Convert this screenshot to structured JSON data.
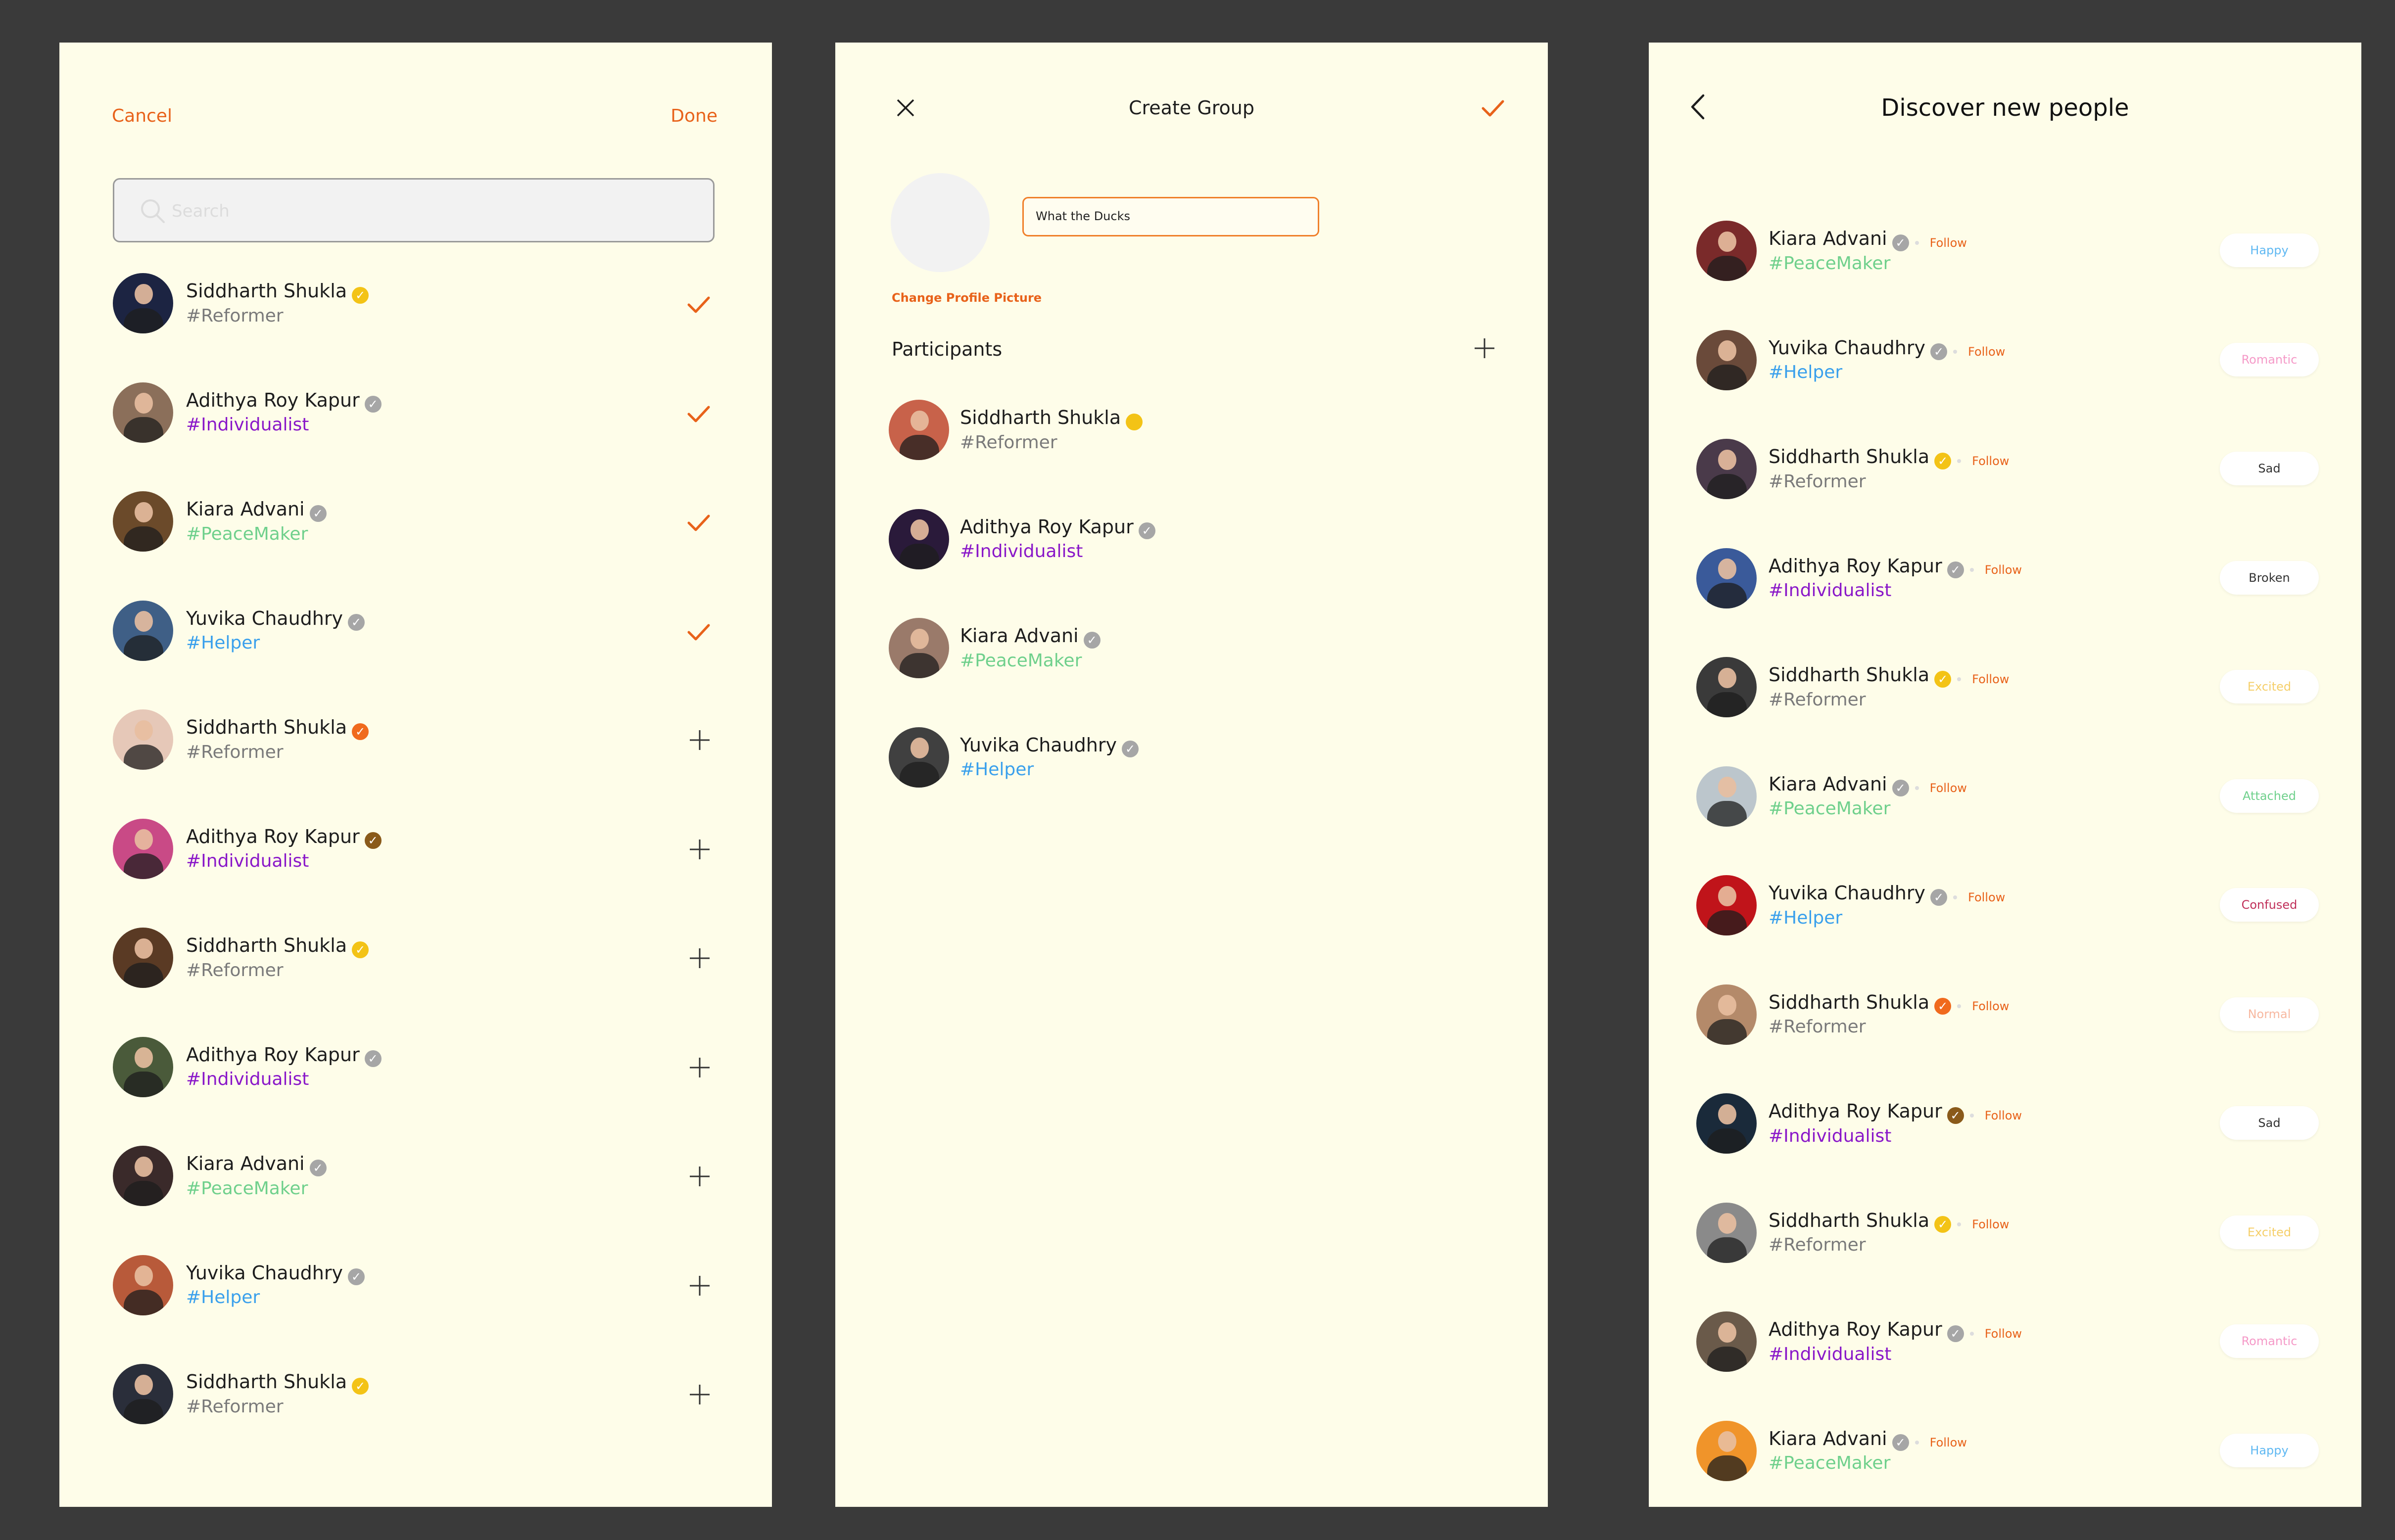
{
  "colors": {
    "accent": "#e8621a",
    "panel_bg": "#fefde9",
    "canvas_bg": "#3a3a3a",
    "tag_reformer": "#7a7a7a",
    "tag_individualist": "#8a18c9",
    "tag_peacemaker": "#6fd08c",
    "tag_helper": "#3aa0ec",
    "badge_yellow": "#f3c316",
    "badge_grey": "#a6a6a6",
    "badge_orange": "#f06a1d",
    "badge_brown": "#8a5a1a"
  },
  "select_panel": {
    "cancel_label": "Cancel",
    "done_label": "Done",
    "search_placeholder": "Search",
    "rows": [
      {
        "name": "Siddharth Shukla",
        "tag": "#Reformer",
        "tag_color": "#7a7a7a",
        "badge": "yellow",
        "selected": true,
        "avatar_bg": "#1c2442"
      },
      {
        "name": "Adithya Roy Kapur",
        "tag": "#Individualist",
        "tag_color": "#8a18c9",
        "badge": "grey",
        "selected": true,
        "avatar_bg": "#8b6f5a"
      },
      {
        "name": "Kiara Advani",
        "tag": "#PeaceMaker",
        "tag_color": "#6fd08c",
        "badge": "grey",
        "selected": true,
        "avatar_bg": "#6b4a2a"
      },
      {
        "name": "Yuvika Chaudhry",
        "tag": "#Helper",
        "tag_color": "#3aa0ec",
        "badge": "grey",
        "selected": true,
        "avatar_bg": "#3f5f86"
      },
      {
        "name": "Siddharth Shukla",
        "tag": "#Reformer",
        "tag_color": "#7a7a7a",
        "badge": "orange",
        "selected": false,
        "avatar_bg": "#e6c8b8"
      },
      {
        "name": "Adithya Roy Kapur",
        "tag": "#Individualist",
        "tag_color": "#8a18c9",
        "badge": "brown",
        "selected": false,
        "avatar_bg": "#c94a86"
      },
      {
        "name": "Siddharth Shukla",
        "tag": "#Reformer",
        "tag_color": "#7a7a7a",
        "badge": "yellow",
        "selected": false,
        "avatar_bg": "#5a3a24"
      },
      {
        "name": "Adithya Roy Kapur",
        "tag": "#Individualist",
        "tag_color": "#8a18c9",
        "badge": "grey",
        "selected": false,
        "avatar_bg": "#4a5a3a"
      },
      {
        "name": "Kiara Advani",
        "tag": "#PeaceMaker",
        "tag_color": "#6fd08c",
        "badge": "grey",
        "selected": false,
        "avatar_bg": "#3a2a2a"
      },
      {
        "name": "Yuvika Chaudhry",
        "tag": "#Helper",
        "tag_color": "#3aa0ec",
        "badge": "grey",
        "selected": false,
        "avatar_bg": "#b85a3a"
      },
      {
        "name": "Siddharth Shukla",
        "tag": "#Reformer",
        "tag_color": "#7a7a7a",
        "badge": "yellow",
        "selected": false,
        "avatar_bg": "#2a2e3a"
      }
    ]
  },
  "create_group": {
    "title": "Create Group",
    "change_picture_label": "Change Profile Picture",
    "group_name_value": "What the Ducks",
    "participants_label": "Participants",
    "participants": [
      {
        "name": "Siddharth Shukla",
        "tag": "#Reformer",
        "tag_color": "#7a7a7a",
        "badge": "yellow",
        "avatar_bg": "#c8624a"
      },
      {
        "name": "Adithya Roy Kapur",
        "tag": "#Individualist",
        "tag_color": "#8a18c9",
        "badge": "grey",
        "avatar_bg": "#2a1a3a"
      },
      {
        "name": "Kiara Advani",
        "tag": "#PeaceMaker",
        "tag_color": "#6fd08c",
        "badge": "grey",
        "avatar_bg": "#9a7a6a"
      },
      {
        "name": "Yuvika Chaudhry",
        "tag": "#Helper",
        "tag_color": "#3aa0ec",
        "badge": "grey",
        "avatar_bg": "#404040"
      }
    ]
  },
  "discover": {
    "title": "Discover new people",
    "follow_label": "Follow",
    "rows": [
      {
        "name": "Kiara Advani",
        "tag": "#PeaceMaker",
        "tag_color": "#6fd08c",
        "badge": "grey",
        "mood": "Happy",
        "mood_color": "#5fb8f2",
        "avatar_bg": "#7a2a2a"
      },
      {
        "name": "Yuvika Chaudhry",
        "tag": "#Helper",
        "tag_color": "#3aa0ec",
        "badge": "grey",
        "mood": "Romantic",
        "mood_color": "#f59ac8",
        "avatar_bg": "#6a4a3a"
      },
      {
        "name": "Siddharth Shukla",
        "tag": "#Reformer",
        "tag_color": "#7a7a7a",
        "badge": "yellow",
        "mood": "Sad",
        "mood_color": "#333333",
        "avatar_bg": "#4a3a4a"
      },
      {
        "name": "Adithya Roy Kapur",
        "tag": "#Individualist",
        "tag_color": "#8a18c9",
        "badge": "grey",
        "mood": "Broken",
        "mood_color": "#333333",
        "avatar_bg": "#3a5a9a"
      },
      {
        "name": "Siddharth Shukla",
        "tag": "#Reformer",
        "tag_color": "#7a7a7a",
        "badge": "yellow",
        "mood": "Excited",
        "mood_color": "#f5cf6a",
        "avatar_bg": "#3a3a3a"
      },
      {
        "name": "Kiara Advani",
        "tag": "#PeaceMaker",
        "tag_color": "#6fd08c",
        "badge": "grey",
        "mood": "Attached",
        "mood_color": "#6fd08c",
        "avatar_bg": "#bcc6cc"
      },
      {
        "name": "Yuvika Chaudhry",
        "tag": "#Helper",
        "tag_color": "#3aa0ec",
        "badge": "grey",
        "mood": "Confused",
        "mood_color": "#c0305a",
        "avatar_bg": "#c0141a"
      },
      {
        "name": "Siddharth Shukla",
        "tag": "#Reformer",
        "tag_color": "#7a7a7a",
        "badge": "orange",
        "mood": "Normal",
        "mood_color": "#f7b8a0",
        "avatar_bg": "#b48a6a"
      },
      {
        "name": "Adithya Roy Kapur",
        "tag": "#Individualist",
        "tag_color": "#8a18c9",
        "badge": "brown",
        "mood": "Sad",
        "mood_color": "#333333",
        "avatar_bg": "#1a2a3a"
      },
      {
        "name": "Siddharth Shukla",
        "tag": "#Reformer",
        "tag_color": "#7a7a7a",
        "badge": "yellow",
        "mood": "Excited",
        "mood_color": "#f5cf6a",
        "avatar_bg": "#8a8a8a"
      },
      {
        "name": "Adithya Roy Kapur",
        "tag": "#Individualist",
        "tag_color": "#8a18c9",
        "badge": "grey",
        "mood": "Romantic",
        "mood_color": "#f59ac8",
        "avatar_bg": "#6a5a4a"
      },
      {
        "name": "Kiara Advani",
        "tag": "#PeaceMaker",
        "tag_color": "#6fd08c",
        "badge": "grey",
        "mood": "Happy",
        "mood_color": "#5fb8f2",
        "avatar_bg": "#f0942a"
      }
    ]
  }
}
